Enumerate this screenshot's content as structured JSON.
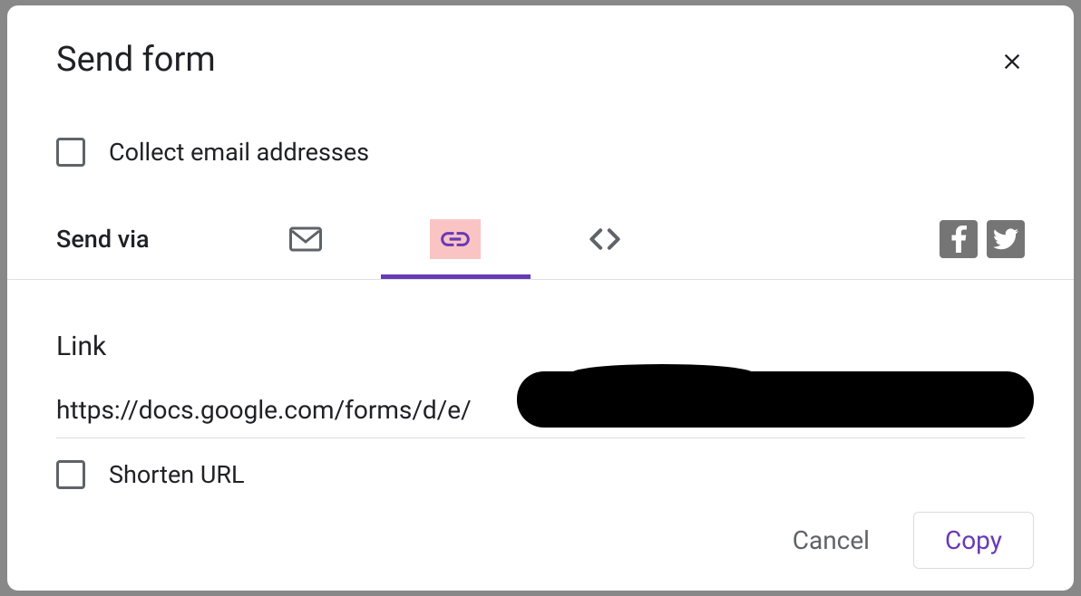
{
  "dialog": {
    "title": "Send form",
    "collect_emails_label": "Collect email addresses",
    "send_via_label": "Send via",
    "link_section_label": "Link",
    "link_value": "https://docs.google.com/forms/d/e/",
    "shorten_url_label": "Shorten URL",
    "cancel_label": "Cancel",
    "copy_label": "Copy"
  },
  "tabs": {
    "active_index": 1,
    "items": [
      {
        "name": "email"
      },
      {
        "name": "link"
      },
      {
        "name": "embed"
      }
    ]
  },
  "social": {
    "facebook": "facebook",
    "twitter": "twitter"
  },
  "colors": {
    "accent": "#673ab7",
    "highlight": "#fbc4c4"
  }
}
